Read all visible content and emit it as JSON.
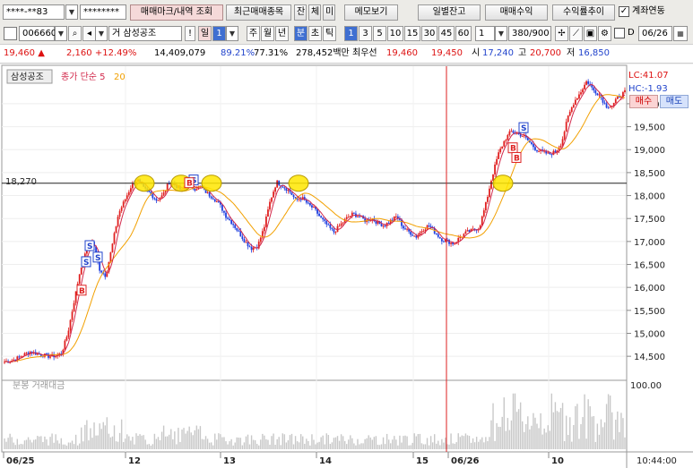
{
  "account": {
    "number": "****-**83",
    "password": "********"
  },
  "toolbar": {
    "trade_mark_button": "매매마크/내역 조회",
    "recent_trades_button": "최근매매종목",
    "balance_tab": "잔",
    "execution_tab": "체",
    "unfilled_tab": "미",
    "memo_button": "메모보기",
    "daily_balance_button": "일별잔고",
    "trade_profit_button": "매매수익",
    "return_trend_button": "수익률추이",
    "account_link_label": "계좌연동",
    "account_link_checked": true
  },
  "symbol": {
    "code": "006660",
    "name": "삼성공조",
    "market": "거"
  },
  "period": {
    "day": "일",
    "day_value": "1",
    "week": "주",
    "month": "월",
    "year": "년",
    "minute": "분",
    "second": "초",
    "tick": "틱",
    "intervals": [
      "1",
      "3",
      "5",
      "10",
      "15",
      "30",
      "45",
      "60"
    ],
    "selected_interval": "1",
    "count_value": "1",
    "view_count": "380",
    "view_total": "/900",
    "date_checkbox": "D",
    "date": "06/26"
  },
  "quote": {
    "price": "19,460",
    "arrow": "▲",
    "change": "2,160",
    "change_pct": "+12.49%",
    "volume": "14,409,079",
    "pct1": "89.21%",
    "pct2": "77.31%",
    "amount": "278,452백만",
    "best_label": "최우선",
    "best_ask": "19,460",
    "best_bid": "19,450",
    "open_label": "시",
    "open": "17,240",
    "high_label": "고",
    "high": "20,700",
    "low_label": "저",
    "low": "16,850"
  },
  "chart_panel": {
    "stock_label": "삼성공조",
    "series1": "종가 단순 5",
    "series1b": "20",
    "lc_label": "LC:41.07",
    "hc_label": "HC:-1.93",
    "buy_button": "매수",
    "sell_button": "매도",
    "ref_line_value": "18,270",
    "volume_label": "분봉 거래대금",
    "volume_top": "100.00",
    "time_label": "10:44:00",
    "colors": {
      "up": "#e02020",
      "down": "#2040e0",
      "ma5": "#d2284b",
      "ma20": "#f2a000",
      "refline": "#222222",
      "vline": "#d22",
      "marker": "#ffe600"
    }
  },
  "chart_data": {
    "type": "candlestick",
    "y_ticks": [
      14500,
      15000,
      15500,
      16000,
      16500,
      17000,
      17500,
      18000,
      18500,
      19000,
      19500,
      20000
    ],
    "y_tick_labels": [
      "14,500",
      "15,000",
      "15,500",
      "16,000",
      "16,500",
      "17,000",
      "17,500",
      "18,000",
      "18,500",
      "19,000",
      "19,500",
      "20,000"
    ],
    "ylim": [
      14230,
      20700
    ],
    "x_labels": [
      "06/25",
      "12",
      "13",
      "14",
      "15",
      "06/26",
      "10"
    ],
    "reference_line": 18270,
    "close_path": [
      14380,
      14400,
      14460,
      14530,
      14600,
      14560,
      14530,
      14500,
      14510,
      14560,
      15000,
      15700,
      16400,
      16900,
      17000,
      16400,
      16250,
      16900,
      17600,
      17900,
      18200,
      18350,
      18150,
      18050,
      17900,
      18000,
      18300,
      18220,
      18100,
      18250,
      18150,
      18200,
      18050,
      17950,
      17800,
      17550,
      17400,
      17200,
      17000,
      16850,
      16900,
      17300,
      17900,
      18300,
      18200,
      18100,
      17900,
      17950,
      17800,
      17700,
      17500,
      17350,
      17200,
      17350,
      17500,
      17600,
      17550,
      17450,
      17500,
      17400,
      17350,
      17450,
      17550,
      17300,
      17200,
      17100,
      17250,
      17350,
      17200,
      17050,
      17000,
      16950,
      17100,
      17200,
      17250,
      17300,
      17800,
      18400,
      18900,
      19200,
      19400,
      19350,
      19300,
      19150,
      19000,
      18950,
      18900,
      18950,
      19150,
      19700,
      20050,
      20250,
      20500,
      20300,
      20200,
      19950,
      19950,
      20150,
      20250
    ],
    "markers": [
      {
        "type": "S",
        "value": 16650
      },
      {
        "type": "S",
        "value": 16900
      },
      {
        "type": "S",
        "value": 16550
      },
      {
        "type": "B",
        "value": 15930
      },
      {
        "type": "S",
        "value": 18330
      },
      {
        "type": "B",
        "value": 18270
      },
      {
        "type": "S",
        "value": 19470
      },
      {
        "type": "B",
        "value": 19030
      },
      {
        "type": "B",
        "value": 18820
      }
    ],
    "highlights": [
      18270,
      18270,
      18270,
      18270,
      18270
    ]
  }
}
